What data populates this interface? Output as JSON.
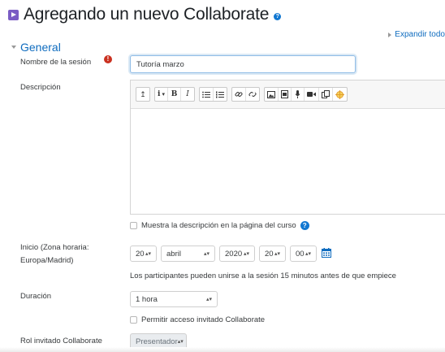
{
  "header": {
    "title": "Agregando un nuevo Collaborate",
    "help_glyph": "?",
    "expand_all": "Expandir todo"
  },
  "section": {
    "title": "General"
  },
  "form": {
    "session_name": {
      "label": "Nombre de la sesión",
      "value": "Tutoría marzo",
      "required_glyph": "!"
    },
    "description": {
      "label": "Descripción",
      "toolbar": {
        "format_glyph": "i",
        "bold_glyph": "B",
        "italic_glyph": "I",
        "collapse_glyph": "↥",
        "dropdown_glyph": "▾"
      }
    },
    "show_description": {
      "label": "Muestra la descripción en la página del curso",
      "help_glyph": "?"
    },
    "start": {
      "label_line1": "Inicio (Zona horaria:",
      "label_line2": "Europa/Madrid)",
      "day": "20",
      "month": "abril",
      "year": "2020",
      "hour": "20",
      "minute": "00",
      "arrows_glyph": "▴▾"
    },
    "hint": "Los participantes pueden unirse a la sesión 15 minutos antes de que empiece",
    "duration": {
      "label": "Duración",
      "value": "1 hora"
    },
    "guest_access": {
      "label": "Permitir acceso invitado Collaborate"
    },
    "guest_role": {
      "label": "Rol invitado Collaborate",
      "value": "Presentador"
    }
  },
  "colors": {
    "link": "#0f6cbf",
    "required": "#ca3120",
    "help": "#1177d1",
    "module_icon": "#7a5cc4"
  }
}
